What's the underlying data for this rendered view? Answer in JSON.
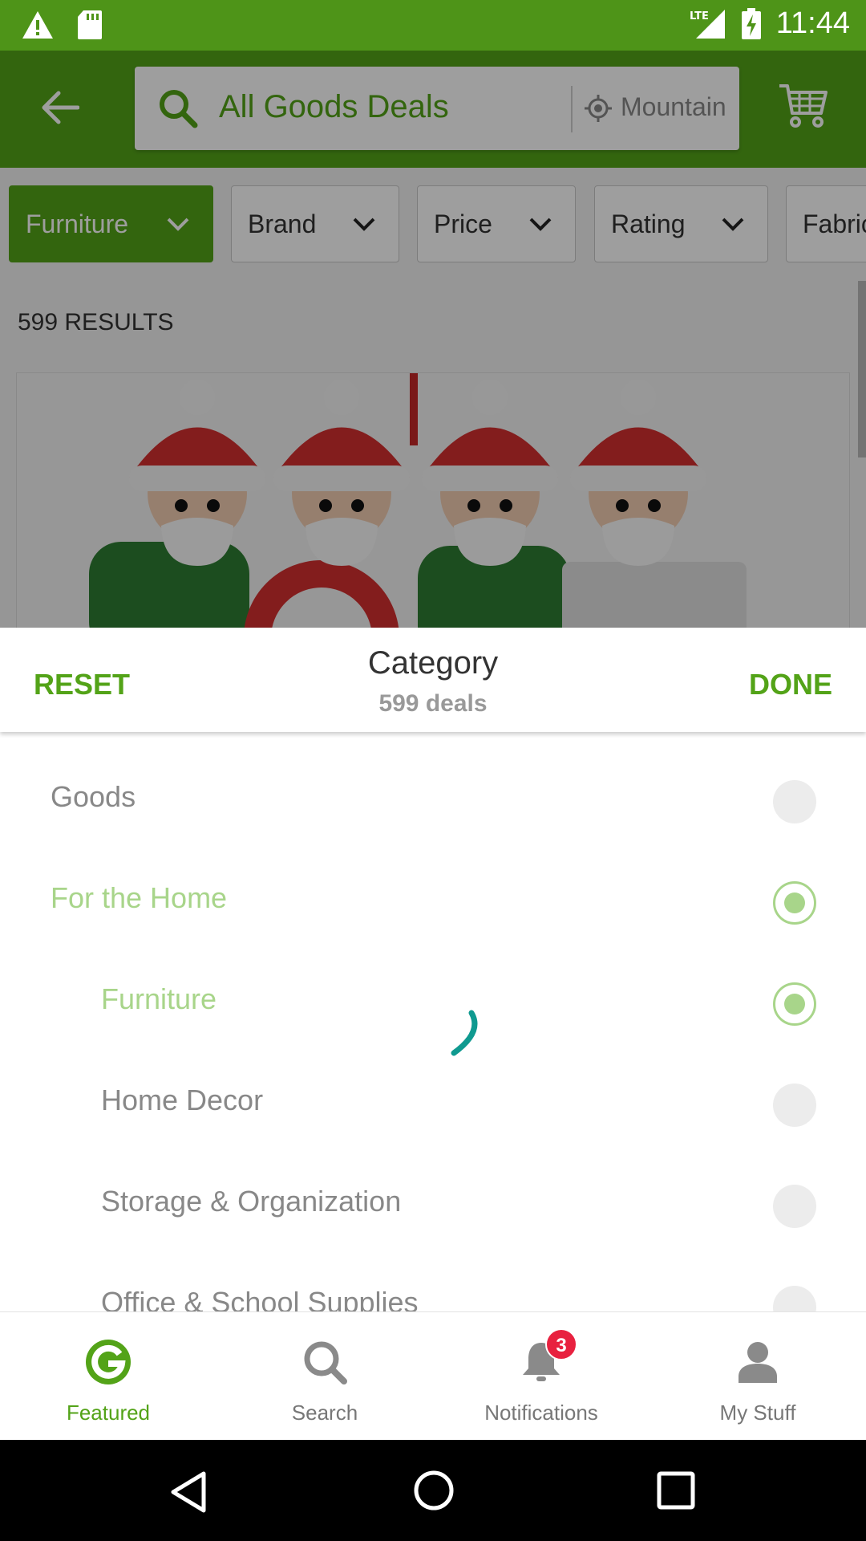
{
  "status_bar": {
    "time": "11:44",
    "network": "LTE"
  },
  "app_bar": {
    "search_text": "All Goods Deals",
    "location_text": "Mountain"
  },
  "filters": [
    {
      "label": "Furniture",
      "active": true
    },
    {
      "label": "Brand",
      "active": false
    },
    {
      "label": "Price",
      "active": false
    },
    {
      "label": "Rating",
      "active": false
    },
    {
      "label": "Fabric",
      "active": false
    }
  ],
  "results": {
    "count_label": "599 RESULTS"
  },
  "sheet": {
    "reset_label": "RESET",
    "title": "Category",
    "subtitle": "599 deals",
    "done_label": "DONE",
    "items": [
      {
        "label": "Goods",
        "selected": false
      },
      {
        "label": "For the Home",
        "selected": true
      },
      {
        "label": "Furniture",
        "selected": true
      },
      {
        "label": "Home Decor",
        "selected": false
      },
      {
        "label": "Storage & Organization",
        "selected": false
      },
      {
        "label": "Office & School Supplies",
        "selected": false
      }
    ]
  },
  "bottom_nav": {
    "items": [
      {
        "label": "Featured",
        "icon": "groupon-g-icon",
        "active": true
      },
      {
        "label": "Search",
        "icon": "search-icon",
        "active": false
      },
      {
        "label": "Notifications",
        "icon": "bell-icon",
        "active": false
      },
      {
        "label": "My Stuff",
        "icon": "person-icon",
        "active": false
      }
    ],
    "notification_badge": "3"
  },
  "colors": {
    "brand_green": "#53a318",
    "selected_light_green": "#a8d58a",
    "badge_red": "#e8213f",
    "spinner_teal": "#0f9a90"
  }
}
